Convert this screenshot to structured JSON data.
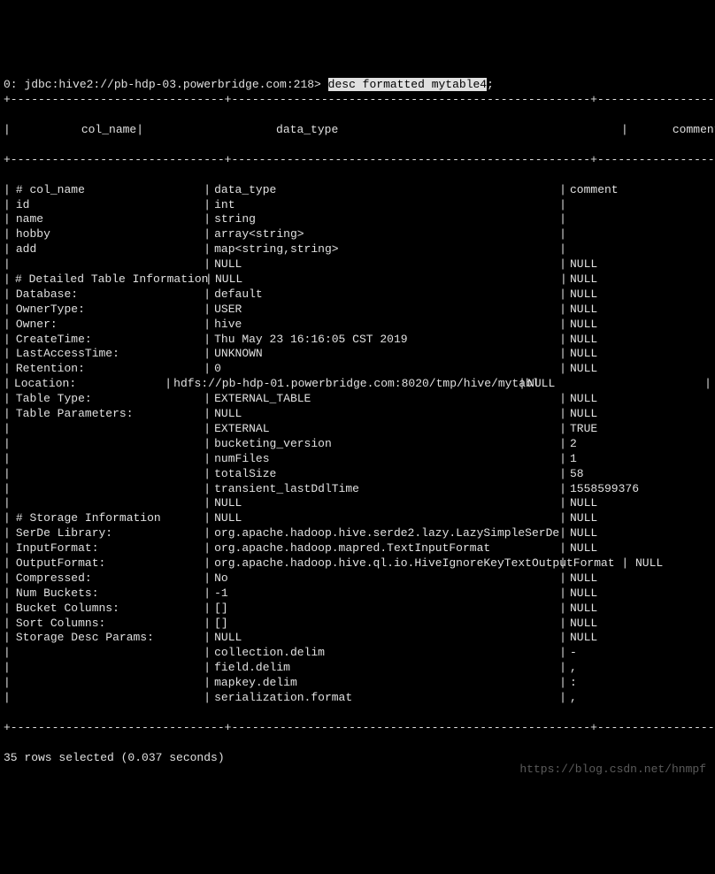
{
  "prompt": {
    "prefix": "0: jdbc:hive2://pb-hdp-03.powerbridge.com:218> ",
    "command": "desc formatted mytable4",
    "suffix": ";"
  },
  "separator": "+-------------------------------+----------------------------------------------------+-----------------------+",
  "header": {
    "c1": "col_name",
    "c2": "data_type",
    "c3": "comment"
  },
  "rows": [
    {
      "c1": "# col_name",
      "c2": "data_type",
      "c3": "comment"
    },
    {
      "c1": "id",
      "c2": "int",
      "c3": ""
    },
    {
      "c1": "name",
      "c2": "string",
      "c3": ""
    },
    {
      "c1": "hobby",
      "c2": "array<string>",
      "c3": ""
    },
    {
      "c1": "add",
      "c2": "map<string,string>",
      "c3": ""
    },
    {
      "c1": "",
      "c2": "NULL",
      "c3": "NULL"
    },
    {
      "c1": "# Detailed Table Information",
      "c2": "NULL",
      "c3": "NULL"
    },
    {
      "c1": "Database:",
      "c2": "default",
      "c3": "NULL"
    },
    {
      "c1": "OwnerType:",
      "c2": "USER",
      "c3": "NULL"
    },
    {
      "c1": "Owner:",
      "c2": "hive",
      "c3": "NULL"
    },
    {
      "c1": "CreateTime:",
      "c2": "Thu May 23 16:16:05 CST 2019",
      "c3": "NULL"
    },
    {
      "c1": "LastAccessTime:",
      "c2": "UNKNOWN",
      "c3": "NULL"
    },
    {
      "c1": "Retention:",
      "c2": "0",
      "c3": "NULL"
    },
    {
      "c1": "Location:",
      "c2": "hdfs://pb-hdp-01.powerbridge.com:8020/tmp/hive/mytabl",
      "c3": "NULL",
      "trail": "|"
    },
    {
      "c1": "Table Type:",
      "c2": "EXTERNAL_TABLE",
      "c3": "NULL"
    },
    {
      "c1": "Table Parameters:",
      "c2": "NULL",
      "c3": "NULL"
    },
    {
      "c1": "",
      "c2": "EXTERNAL",
      "c3": "TRUE"
    },
    {
      "c1": "",
      "c2": "bucketing_version",
      "c3": "2"
    },
    {
      "c1": "",
      "c2": "numFiles",
      "c3": "1"
    },
    {
      "c1": "",
      "c2": "totalSize",
      "c3": "58"
    },
    {
      "c1": "",
      "c2": "transient_lastDdlTime",
      "c3": "1558599376"
    },
    {
      "c1": "",
      "c2": "NULL",
      "c3": "NULL"
    },
    {
      "c1": "# Storage Information",
      "c2": "NULL",
      "c3": "NULL"
    },
    {
      "c1": "SerDe Library:",
      "c2": "org.apache.hadoop.hive.serde2.lazy.LazySimpleSerDe",
      "c3": "NULL"
    },
    {
      "c1": "InputFormat:",
      "c2": "org.apache.hadoop.mapred.TextInputFormat",
      "c3": "NULL"
    },
    {
      "c1": "OutputFormat:",
      "c2": "org.apache.hadoop.hive.ql.io.HiveIgnoreKeyTextOutputFormat | NULL",
      "c3": ""
    },
    {
      "c1": "Compressed:",
      "c2": "No",
      "c3": "NULL"
    },
    {
      "c1": "Num Buckets:",
      "c2": "-1",
      "c3": "NULL"
    },
    {
      "c1": "Bucket Columns:",
      "c2": "[]",
      "c3": "NULL"
    },
    {
      "c1": "Sort Columns:",
      "c2": "[]",
      "c3": "NULL"
    },
    {
      "c1": "Storage Desc Params:",
      "c2": "NULL",
      "c3": "NULL"
    },
    {
      "c1": "",
      "c2": "collection.delim",
      "c3": "-"
    },
    {
      "c1": "",
      "c2": "field.delim",
      "c3": ","
    },
    {
      "c1": "",
      "c2": "mapkey.delim",
      "c3": ":"
    },
    {
      "c1": "",
      "c2": "serialization.format",
      "c3": ","
    }
  ],
  "footer": "35 rows selected (0.037 seconds)",
  "watermark": "https://blog.csdn.net/hnmpf"
}
